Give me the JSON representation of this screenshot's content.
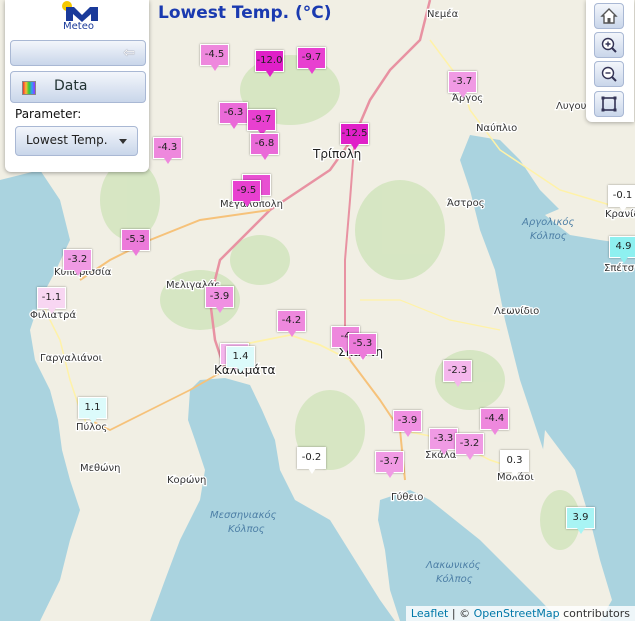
{
  "title": "Lowest Temp. (°C)",
  "logo": {
    "text": "Meteo"
  },
  "panel": {
    "data_label": "Data",
    "parameter_label": "Parameter:",
    "parameter_value": "Lowest Temp."
  },
  "tools": [
    "home-icon",
    "zoom-in-icon",
    "zoom-out-icon",
    "fullscreen-icon"
  ],
  "attribution": {
    "leaflet": "Leaflet",
    "sep": " | © ",
    "osm": "OpenStreetMap",
    "rest": " contributors"
  },
  "places": [
    {
      "name": "Νεμέα",
      "size": "small"
    },
    {
      "name": "Άργος",
      "size": "small"
    },
    {
      "name": "Λυγου",
      "size": "small"
    },
    {
      "name": "Ναύπλιο",
      "size": "small"
    },
    {
      "name": "Τρίπολη",
      "size": "big"
    },
    {
      "name": "Μεγαλόπολη",
      "size": "small"
    },
    {
      "name": "Άστρος",
      "size": "small"
    },
    {
      "name": "Κρανίδ",
      "size": "small"
    },
    {
      "name": "Σπέτσ",
      "size": "small"
    },
    {
      "name": "Κυπαρισσία",
      "size": "small"
    },
    {
      "name": "Μελιγαλάς",
      "size": "small"
    },
    {
      "name": "Φιλιατρά",
      "size": "small"
    },
    {
      "name": "Λεωνίδιο",
      "size": "small"
    },
    {
      "name": "Γαργαλιάνοι",
      "size": "small"
    },
    {
      "name": "Καλαμάτα",
      "size": "big"
    },
    {
      "name": "Σπάρτη",
      "size": "big"
    },
    {
      "name": "Πύλος",
      "size": "small"
    },
    {
      "name": "Σκάλα",
      "size": "small"
    },
    {
      "name": "Μολάοι",
      "size": "small"
    },
    {
      "name": "Μεθώνη",
      "size": "small"
    },
    {
      "name": "Κορώνη",
      "size": "small"
    },
    {
      "name": "Γύθειο",
      "size": "small"
    }
  ],
  "seas": [
    "Αργολικός",
    "Κόλπος",
    "Μεσσηνιακός",
    "Κόλπος",
    "Λακωνικός",
    "Κόλπος"
  ],
  "stations": [
    {
      "value": "-4.5",
      "color": "#ee88dd"
    },
    {
      "value": "-12.0",
      "color": "#e020c8"
    },
    {
      "value": "-9.7",
      "color": "#e840d0"
    },
    {
      "value": "-3.7",
      "color": "#f09ae4"
    },
    {
      "value": "-6.3",
      "color": "#ea6ad8"
    },
    {
      "value": "-9.7",
      "color": "#e840d0"
    },
    {
      "value": "-12.5",
      "color": "#e020c8"
    },
    {
      "value": "-4.3",
      "color": "#ee88dd"
    },
    {
      "value": "-6.8",
      "color": "#ea6ad8"
    },
    {
      "value": "-8",
      "color": "#e850d2"
    },
    {
      "value": "-9.5",
      "color": "#e840d0"
    },
    {
      "value": "-0.1",
      "color": "#ffffff"
    },
    {
      "value": "-5.3",
      "color": "#ec7ada"
    },
    {
      "value": "4.9",
      "color": "#8ef0f0"
    },
    {
      "value": "-3.2",
      "color": "#f09ae4"
    },
    {
      "value": "-1.1",
      "color": "#f8d6f2"
    },
    {
      "value": "-3.9",
      "color": "#f090e2"
    },
    {
      "value": "-4.2",
      "color": "#ee88dd"
    },
    {
      "value": "-4",
      "color": "#ee88dd"
    },
    {
      "value": "-5.3",
      "color": "#ec7ada"
    },
    {
      "value": "-2",
      "color": "#f4b6ec"
    },
    {
      "value": "1.4",
      "color": "#dcfbfb"
    },
    {
      "value": "-2.3",
      "color": "#f4b6ec"
    },
    {
      "value": "1.1",
      "color": "#dcfbfb"
    },
    {
      "value": "-3.9",
      "color": "#f090e2"
    },
    {
      "value": "-4.4",
      "color": "#ee88dd"
    },
    {
      "value": "-3.3",
      "color": "#f09ae4"
    },
    {
      "value": "-3.2",
      "color": "#f09ae4"
    },
    {
      "value": "-0.2",
      "color": "#ffffff"
    },
    {
      "value": "-3.7",
      "color": "#f09ae4"
    },
    {
      "value": "0.3",
      "color": "#ffffff"
    },
    {
      "value": "3.9",
      "color": "#a8f4f4"
    }
  ]
}
